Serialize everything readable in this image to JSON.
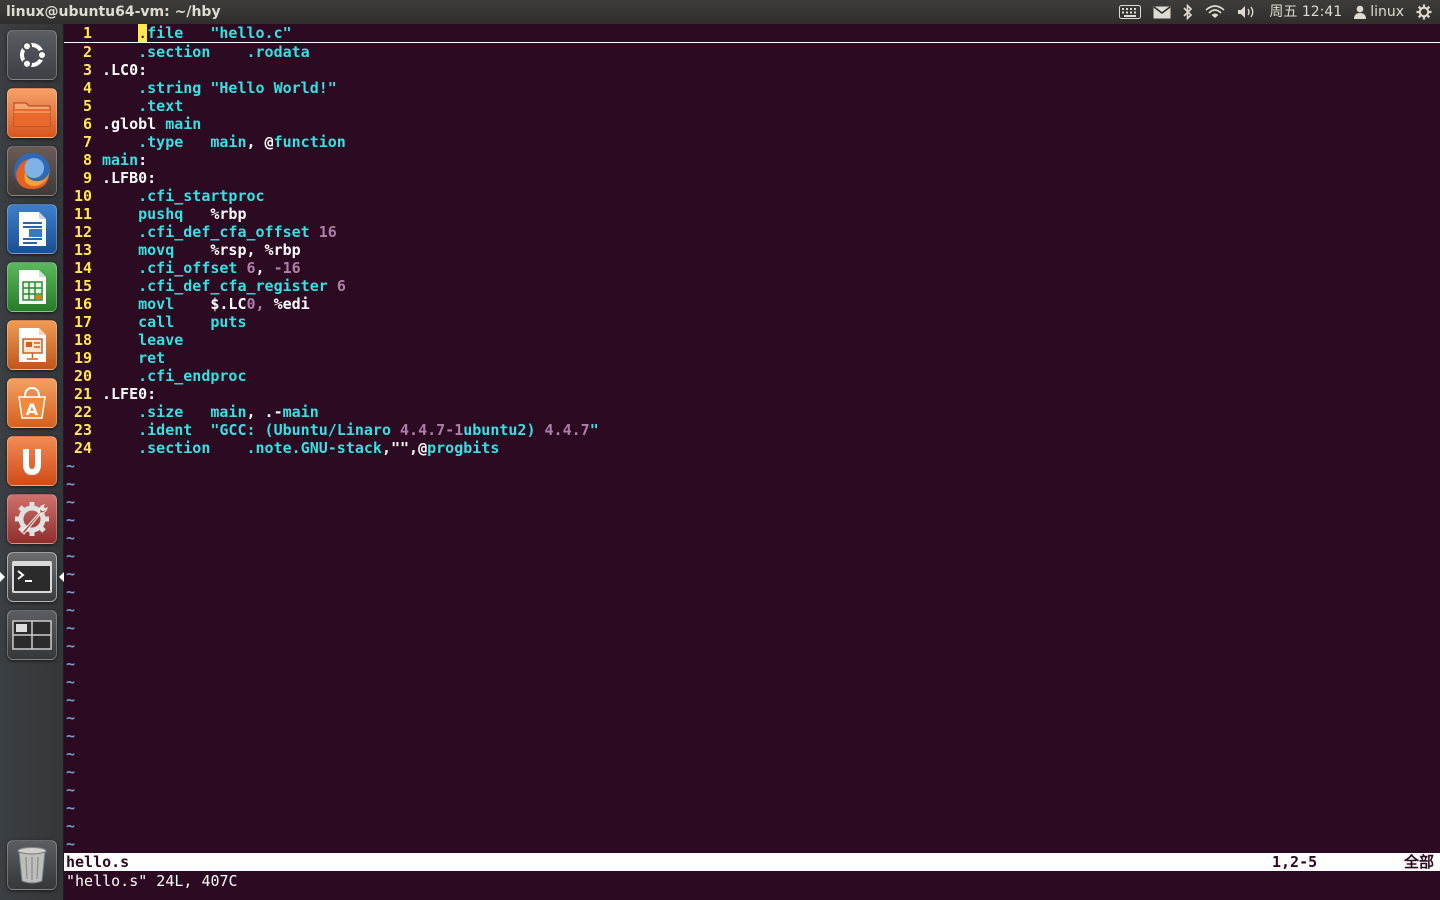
{
  "window": {
    "title": "linux@ubuntu64-vm: ~/hby"
  },
  "panel": {
    "clock": "周五 12:41",
    "user": "linux"
  },
  "launcher": {
    "items": [
      {
        "name": "dash-home",
        "icon": "ubuntu-logo-icon"
      },
      {
        "name": "files",
        "icon": "folder-icon"
      },
      {
        "name": "firefox",
        "icon": "firefox-icon"
      },
      {
        "name": "writer",
        "icon": "libreoffice-writer-icon"
      },
      {
        "name": "calc",
        "icon": "libreoffice-calc-icon"
      },
      {
        "name": "impress",
        "icon": "libreoffice-impress-icon"
      },
      {
        "name": "software-center",
        "icon": "software-center-icon"
      },
      {
        "name": "ubuntu-one",
        "icon": "ubuntu-one-icon"
      },
      {
        "name": "system-settings",
        "icon": "settings-icon"
      },
      {
        "name": "terminal",
        "icon": "terminal-icon"
      },
      {
        "name": "workspaces",
        "icon": "workspace-switcher-icon"
      },
      {
        "name": "trash",
        "icon": "trash-icon"
      }
    ]
  },
  "editor": {
    "lines": [
      {
        "n": "1",
        "parts": [
          {
            "t": "    ",
            "c": "pl"
          },
          {
            "t": ".",
            "c": "cursor"
          },
          {
            "t": "file",
            "c": "kw"
          },
          {
            "t": "   ",
            "c": "pl"
          },
          {
            "t": "\"hello.c\"",
            "c": "st"
          }
        ]
      },
      {
        "n": "2",
        "parts": [
          {
            "t": "    ",
            "c": "pl"
          },
          {
            "t": ".section",
            "c": "kw"
          },
          {
            "t": "    ",
            "c": "pl"
          },
          {
            "t": ".rodata",
            "c": "kw"
          }
        ]
      },
      {
        "n": "3",
        "parts": [
          {
            "t": ".LC0:",
            "c": "lb"
          }
        ]
      },
      {
        "n": "4",
        "parts": [
          {
            "t": "    ",
            "c": "pl"
          },
          {
            "t": ".string",
            "c": "kw"
          },
          {
            "t": " ",
            "c": "pl"
          },
          {
            "t": "\"Hello World!\"",
            "c": "st"
          }
        ]
      },
      {
        "n": "5",
        "parts": [
          {
            "t": "    ",
            "c": "pl"
          },
          {
            "t": ".text",
            "c": "kw"
          }
        ]
      },
      {
        "n": "6",
        "parts": [
          {
            "t": ".globl",
            "c": "lb"
          },
          {
            "t": " ",
            "c": "pl"
          },
          {
            "t": "main",
            "c": "kw"
          }
        ]
      },
      {
        "n": "7",
        "parts": [
          {
            "t": "    ",
            "c": "pl"
          },
          {
            "t": ".type",
            "c": "kw"
          },
          {
            "t": "   ",
            "c": "pl"
          },
          {
            "t": "main",
            "c": "kw"
          },
          {
            "t": ", @",
            "c": "pl"
          },
          {
            "t": "function",
            "c": "kw"
          }
        ]
      },
      {
        "n": "8",
        "parts": [
          {
            "t": "main",
            "c": "kw"
          },
          {
            "t": ":",
            "c": "lb"
          }
        ]
      },
      {
        "n": "9",
        "parts": [
          {
            "t": ".LFB0:",
            "c": "lb"
          }
        ]
      },
      {
        "n": "10",
        "parts": [
          {
            "t": "    ",
            "c": "pl"
          },
          {
            "t": ".cfi_startproc",
            "c": "kw"
          }
        ]
      },
      {
        "n": "11",
        "parts": [
          {
            "t": "    ",
            "c": "pl"
          },
          {
            "t": "pushq",
            "c": "kw"
          },
          {
            "t": "   ",
            "c": "pl"
          },
          {
            "t": "%rbp",
            "c": "lb"
          }
        ]
      },
      {
        "n": "12",
        "parts": [
          {
            "t": "    ",
            "c": "pl"
          },
          {
            "t": ".cfi_def_cfa_offset",
            "c": "kw"
          },
          {
            "t": " ",
            "c": "pl"
          },
          {
            "t": "16",
            "c": "nm"
          }
        ]
      },
      {
        "n": "13",
        "parts": [
          {
            "t": "    ",
            "c": "pl"
          },
          {
            "t": "movq",
            "c": "kw"
          },
          {
            "t": "    ",
            "c": "pl"
          },
          {
            "t": "%rsp, %rbp",
            "c": "lb"
          }
        ]
      },
      {
        "n": "14",
        "parts": [
          {
            "t": "    ",
            "c": "pl"
          },
          {
            "t": ".cfi_offset",
            "c": "kw"
          },
          {
            "t": " ",
            "c": "pl"
          },
          {
            "t": "6",
            "c": "nm"
          },
          {
            "t": ", ",
            "c": "pl"
          },
          {
            "t": "-16",
            "c": "nm"
          }
        ]
      },
      {
        "n": "15",
        "parts": [
          {
            "t": "    ",
            "c": "pl"
          },
          {
            "t": ".cfi_def_cfa_register",
            "c": "kw"
          },
          {
            "t": " ",
            "c": "pl"
          },
          {
            "t": "6",
            "c": "nm"
          }
        ]
      },
      {
        "n": "16",
        "parts": [
          {
            "t": "    ",
            "c": "pl"
          },
          {
            "t": "movl",
            "c": "kw"
          },
          {
            "t": "    ",
            "c": "pl"
          },
          {
            "t": "$.LC",
            "c": "lb"
          },
          {
            "t": "0",
            "c": "nm"
          },
          {
            "t": ", ",
            "c": "nm"
          },
          {
            "t": "%edi",
            "c": "lb"
          }
        ]
      },
      {
        "n": "17",
        "parts": [
          {
            "t": "    ",
            "c": "pl"
          },
          {
            "t": "call",
            "c": "kw"
          },
          {
            "t": "    ",
            "c": "pl"
          },
          {
            "t": "puts",
            "c": "kw"
          }
        ]
      },
      {
        "n": "18",
        "parts": [
          {
            "t": "    ",
            "c": "pl"
          },
          {
            "t": "leave",
            "c": "kw"
          }
        ]
      },
      {
        "n": "19",
        "parts": [
          {
            "t": "    ",
            "c": "pl"
          },
          {
            "t": "ret",
            "c": "kw"
          }
        ]
      },
      {
        "n": "20",
        "parts": [
          {
            "t": "    ",
            "c": "pl"
          },
          {
            "t": ".cfi_endproc",
            "c": "kw"
          }
        ]
      },
      {
        "n": "21",
        "parts": [
          {
            "t": ".LFE0:",
            "c": "lb"
          }
        ]
      },
      {
        "n": "22",
        "parts": [
          {
            "t": "    ",
            "c": "pl"
          },
          {
            "t": ".size",
            "c": "kw"
          },
          {
            "t": "   ",
            "c": "pl"
          },
          {
            "t": "main",
            "c": "kw"
          },
          {
            "t": ", .-",
            "c": "lb"
          },
          {
            "t": "main",
            "c": "kw"
          }
        ]
      },
      {
        "n": "23",
        "parts": [
          {
            "t": "    ",
            "c": "pl"
          },
          {
            "t": ".ident",
            "c": "kw"
          },
          {
            "t": "  ",
            "c": "pl"
          },
          {
            "t": "\"GCC: (",
            "c": "st"
          },
          {
            "t": "Ubuntu",
            "c": "kw"
          },
          {
            "t": "/",
            "c": "st"
          },
          {
            "t": "Linaro",
            "c": "kw"
          },
          {
            "t": " ",
            "c": "st"
          },
          {
            "t": "4.4.7-1",
            "c": "nm"
          },
          {
            "t": "ubuntu2",
            "c": "kw"
          },
          {
            "t": ") ",
            "c": "st"
          },
          {
            "t": "4.4.7",
            "c": "nm"
          },
          {
            "t": "\"",
            "c": "st"
          }
        ]
      },
      {
        "n": "24",
        "parts": [
          {
            "t": "    ",
            "c": "pl"
          },
          {
            "t": ".section",
            "c": "kw"
          },
          {
            "t": "    ",
            "c": "pl"
          },
          {
            "t": ".note.GNU-stack",
            "c": "kw"
          },
          {
            "t": ",\"\",@",
            "c": "lb"
          },
          {
            "t": "progbits",
            "c": "kw"
          }
        ]
      }
    ],
    "tilde": "~",
    "tilde_count": 22
  },
  "statusline": {
    "file": "hello.s",
    "position": "1,2-5",
    "scroll": "全部"
  },
  "message": "\"hello.s\" 24L, 407C",
  "colors": {
    "background": "#2c0a22",
    "line_number": "#fce94f",
    "keyword": "#34e2e2",
    "number": "#ad7fa8",
    "tilde": "#729fcf"
  }
}
